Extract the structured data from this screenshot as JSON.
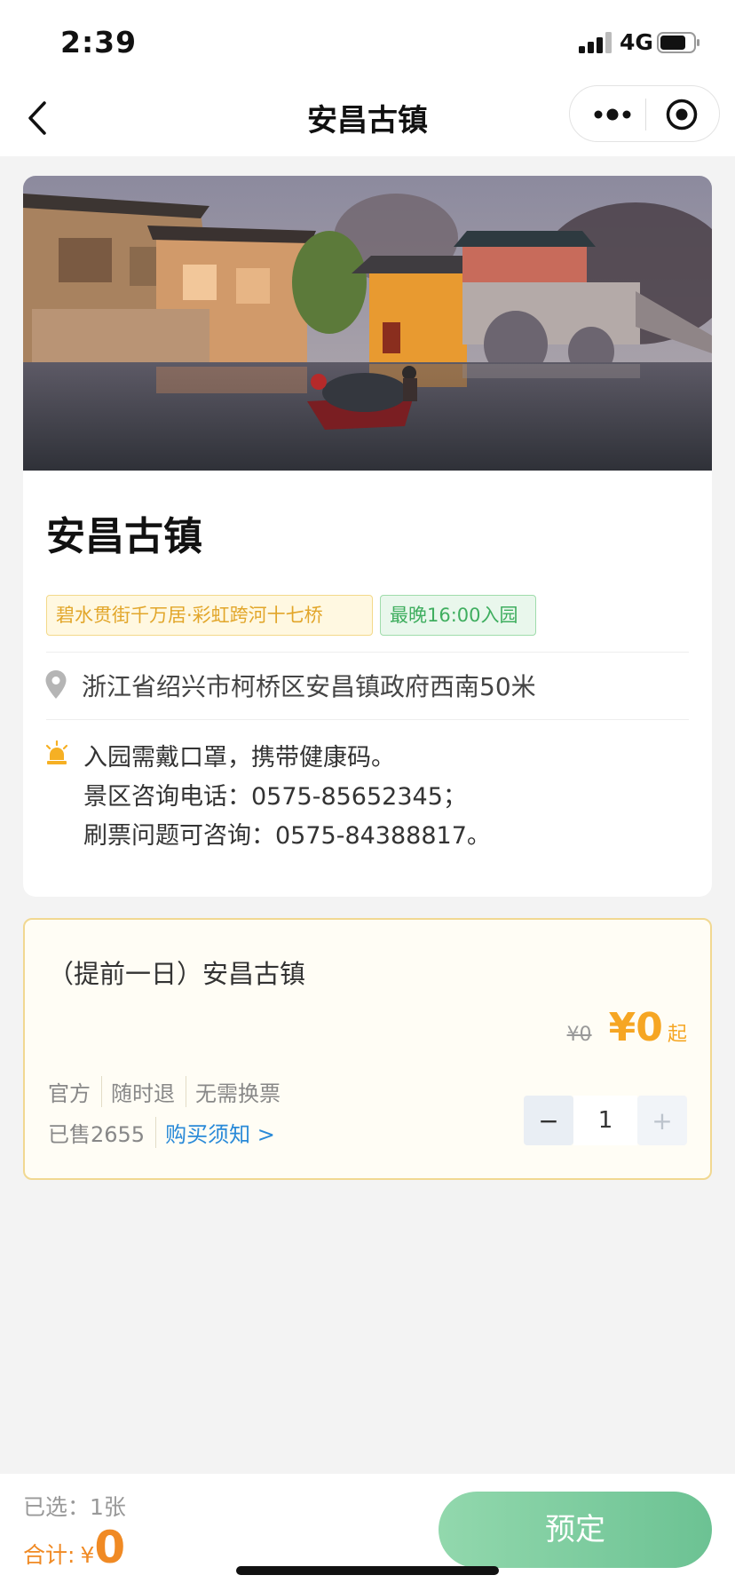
{
  "status_bar": {
    "time": "2:39",
    "network": "4G"
  },
  "nav": {
    "title": "安昌古镇"
  },
  "spot": {
    "name": "安昌古镇",
    "tags": [
      "碧水贯街千万居·彩虹跨河十七桥",
      "最晚16:00入园"
    ],
    "address": "浙江省绍兴市柯桥区安昌镇政府西南50米",
    "notice_lines": [
      "入园需戴口罩，携带健康码。",
      "景区咨询电话：0575-85652345；",
      "刷票问题可咨询：0575-84388817。"
    ]
  },
  "ticket": {
    "name": "（提前一日）安昌古镇",
    "original_price": "¥0",
    "price": "¥0",
    "price_suffix": "起",
    "attributes": [
      "官方",
      "随时退",
      "无需换票"
    ],
    "sold": "已售2655",
    "notice_link": "购买须知 >",
    "quantity": "1",
    "minus": "−",
    "plus": "+"
  },
  "bottom": {
    "selected": "已选：1张",
    "total_label": "合计:",
    "total_currency": "¥",
    "total_value": "0",
    "book_button": "预定"
  },
  "colors": {
    "accent_orange": "#f6a623",
    "total_orange": "#f08a24",
    "link_blue": "#2a8ad8",
    "button_green": "#6cc293"
  }
}
